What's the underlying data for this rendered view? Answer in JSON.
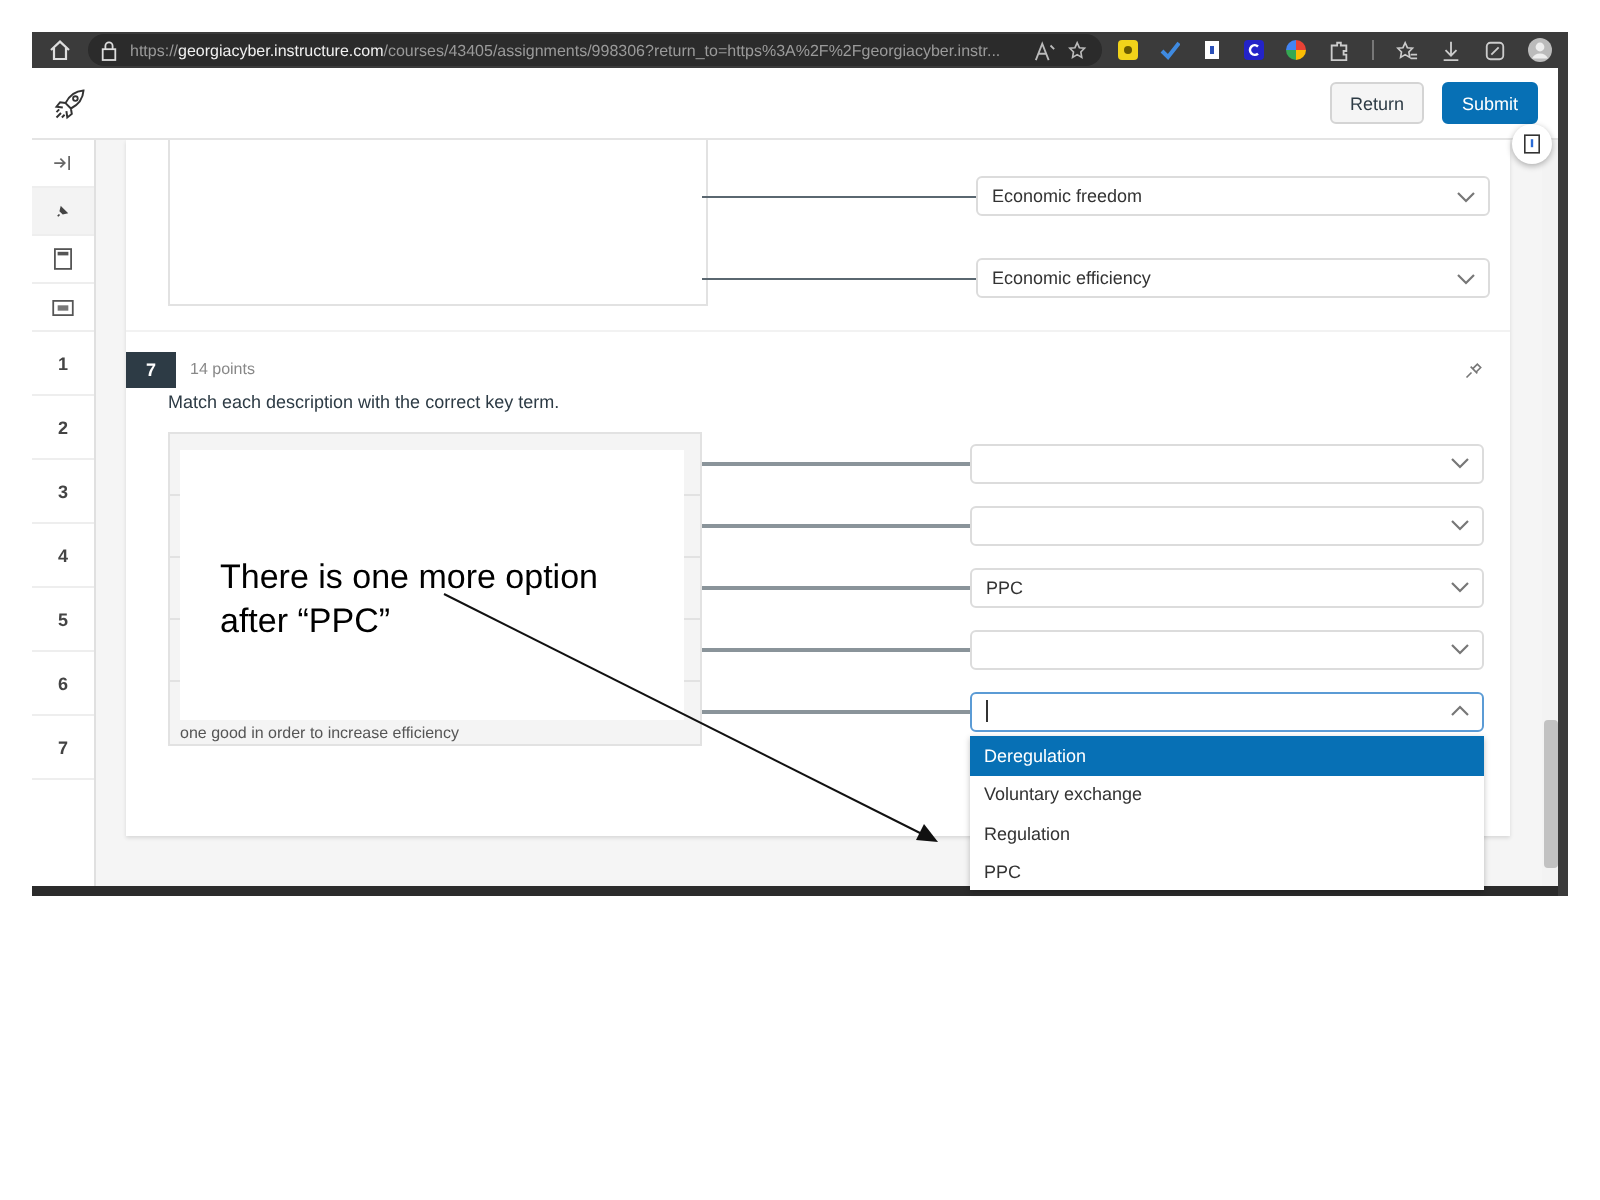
{
  "browser": {
    "url": "https://**georgiacyber.instructure.com**/courses/43405/assignments/998306?return_to=https%3A%2F%2Fgeorgiacyber.instr..."
  },
  "header": {
    "buttons": [
      {
        "label": "Return",
        "kind": "secondary"
      },
      {
        "label": "Submit",
        "kind": "primary"
      }
    ]
  },
  "sidebar": {
    "questions": [
      {
        "label": "1"
      },
      {
        "label": "2"
      },
      {
        "label": "3"
      },
      {
        "label": "4"
      },
      {
        "label": "5"
      },
      {
        "label": "6"
      },
      {
        "label": "7"
      }
    ]
  },
  "question_6": {
    "rows": [
      {
        "answer": {
          "value": "Economic freedom",
          "open": false
        }
      },
      {
        "answer": {
          "value": "Economic efficiency",
          "open": false
        }
      }
    ]
  },
  "question_7": {
    "number": "7",
    "points": "14 points",
    "prompt": "Match each description with the correct key term.",
    "rows": [
      {
        "answer": {
          "open": false
        }
      },
      {
        "answer": {
          "open": false
        }
      },
      {
        "answer": {
          "value": "PPC",
          "open": false
        }
      },
      {
        "answer": {
          "open": false
        }
      },
      {
        "description": "one good in order to increase efficiency",
        "answer": {
          "open": true
        }
      }
    ],
    "options": [
      {
        "label": "Deregulation",
        "selected": true
      },
      {
        "label": "Voluntary exchange",
        "selected": false
      },
      {
        "label": "Regulation",
        "selected": false
      },
      {
        "label": "PPC",
        "selected": false
      }
    ]
  },
  "annotation": {
    "text": "There is one more option after “PPC”"
  }
}
